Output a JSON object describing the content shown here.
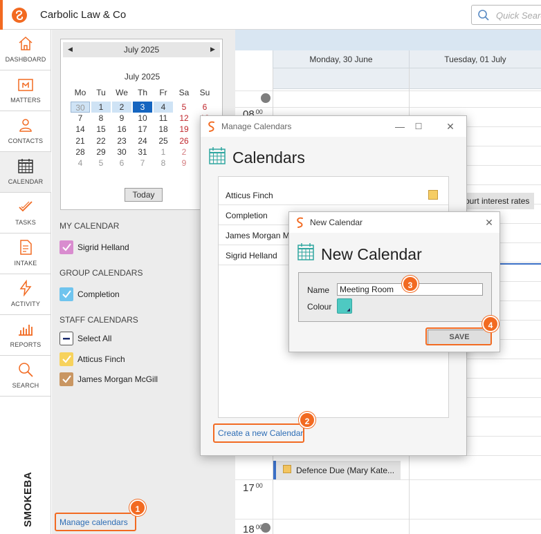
{
  "app": {
    "title": "Carbolic Law & Co",
    "search_placeholder": "Quick Search",
    "brand": "SMOKEBALL"
  },
  "nav": [
    {
      "label": "DASHBOARD",
      "icon": "house-icon"
    },
    {
      "label": "MATTERS",
      "icon": "matter-folder-icon"
    },
    {
      "label": "CONTACTS",
      "icon": "people-icon"
    },
    {
      "label": "CALENDAR",
      "icon": "calendar-icon",
      "active": true
    },
    {
      "label": "TASKS",
      "icon": "tasks-check-icon"
    },
    {
      "label": "INTAKE",
      "icon": "intake-doc-icon"
    },
    {
      "label": "ACTIVITY",
      "icon": "lightning-icon"
    },
    {
      "label": "REPORTS",
      "icon": "bar-chart-icon"
    },
    {
      "label": "SEARCH",
      "icon": "search-icon"
    }
  ],
  "minical": {
    "header_month": "July 2025",
    "month_title": "July 2025",
    "days_of_week": [
      "Mo",
      "Tu",
      "We",
      "Th",
      "Fr",
      "Sa",
      "Su"
    ],
    "weeks": [
      [
        "30",
        "1",
        "2",
        "3",
        "4",
        "5",
        "6"
      ],
      [
        "7",
        "8",
        "9",
        "10",
        "11",
        "12",
        "13"
      ],
      [
        "14",
        "15",
        "16",
        "17",
        "18",
        "19",
        "20"
      ],
      [
        "21",
        "22",
        "23",
        "24",
        "25",
        "26",
        "27"
      ],
      [
        "28",
        "29",
        "30",
        "31",
        "1",
        "2",
        "3"
      ],
      [
        "4",
        "5",
        "6",
        "7",
        "8",
        "9",
        "10"
      ]
    ],
    "today_label": "Today"
  },
  "my_calendar": {
    "heading": "MY CALENDAR",
    "items": [
      {
        "label": "Sigrid Helland",
        "color": "#d98ccf"
      }
    ]
  },
  "group_calendars": {
    "heading": "GROUP CALENDARS",
    "items": [
      {
        "label": "Completion",
        "color": "#6fc4ee"
      }
    ]
  },
  "staff_calendars": {
    "heading": "STAFF CALENDARS",
    "items": [
      {
        "label": "Select All",
        "color": "#ffffff"
      },
      {
        "label": "Atticus Finch",
        "color": "#f7d25c"
      },
      {
        "label": "James Morgan McGill",
        "color": "#c99662"
      }
    ]
  },
  "manage_calendars_link": "Manage calendars",
  "calendar_view": {
    "days": [
      "Monday, 30 June",
      "Tuesday, 01 July"
    ],
    "hours": [
      {
        "hour": "08",
        "min": "00"
      },
      {
        "hour": "17",
        "min": "00"
      },
      {
        "hour": "18",
        "min": "00"
      }
    ],
    "events": [
      {
        "text": "ourt interest rates"
      },
      {
        "text": "Defence Due (Mary Kate..."
      }
    ]
  },
  "manage_dialog": {
    "window_title": "Manage Calendars",
    "heading": "Calendars",
    "calendars": [
      {
        "name": "Atticus Finch"
      },
      {
        "name": "Completion"
      },
      {
        "name": "James Morgan M"
      },
      {
        "name": "Sigrid Helland"
      }
    ],
    "create_link": "Create a new Calendar"
  },
  "new_dialog": {
    "window_title": "New Calendar",
    "heading": "New Calendar",
    "name_label": "Name",
    "name_value": "Meeting Room",
    "colour_label": "Colour",
    "colour_value": "#4ec9c2",
    "save_label": "SAVE"
  },
  "callouts": [
    "1",
    "2",
    "3",
    "4"
  ]
}
